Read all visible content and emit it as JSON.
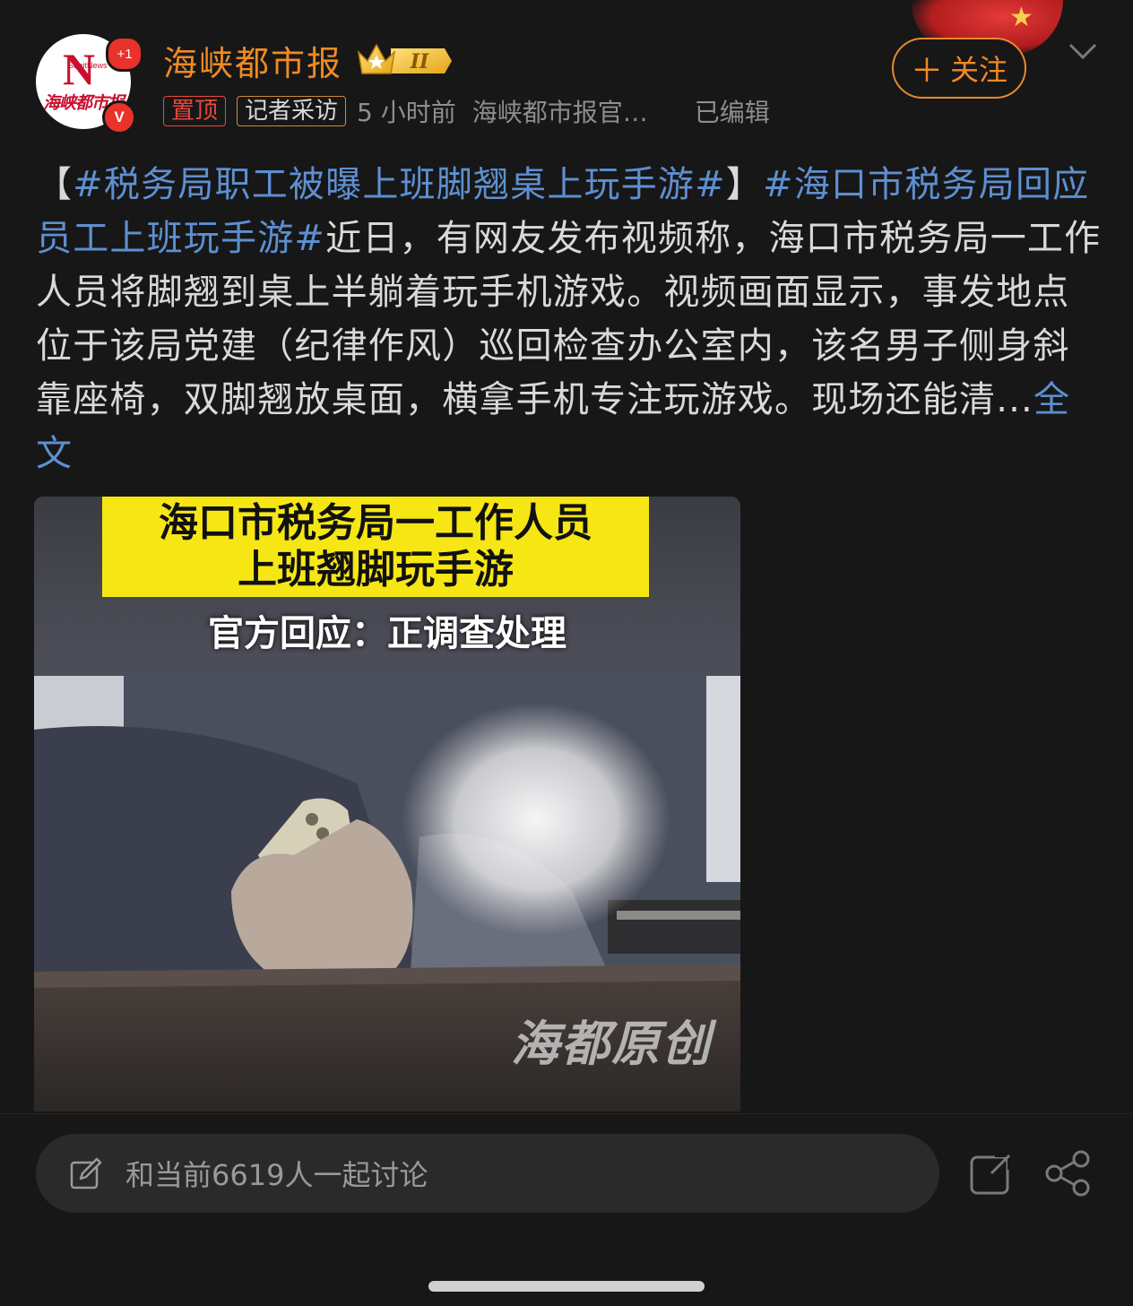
{
  "header": {
    "avatar": {
      "logo_letter": "N",
      "logo_sub": "StraitNews",
      "logo_cn": "海峡都市报"
    },
    "avatar_badge": "+1",
    "verified_badge": "V",
    "author_name": "海峡都市报",
    "level_badge": "II",
    "tags": {
      "pinned": "置顶",
      "reporter": "记者采访"
    },
    "time": "5 小时前",
    "source": "海峡都市报官…",
    "edited": "已编辑",
    "follow_plus": "＋",
    "follow_label": "关注"
  },
  "post": {
    "bracket_open": "【",
    "hashtag1": "#税务局职工被曝上班脚翘桌上玩手游#",
    "bracket_close": "】",
    "hashtag2": "#海口市税务局回应员工上班玩手游#",
    "body": "近日，有网友发布视频称，海口市税务局一工作人员将脚翘到桌上半躺着玩手机游戏。视频画面显示，事发地点位于该局党建（纪律作风）巡回检查办公室内，该名男子侧身斜靠座椅，双脚翘放桌面，横拿手机专注玩游戏。现场还能清...",
    "more": "全文"
  },
  "media": {
    "headline_line1": "海口市税务局一工作人员",
    "headline_line2": "上班翘脚玩手游",
    "subtitle": "官方回应：正调查处理",
    "watermark": "海都原创"
  },
  "footer": {
    "comment_placeholder": "和当前6619人一起讨论",
    "icons": [
      "edit-icon",
      "comment-compose-icon",
      "share-icon"
    ]
  },
  "colors": {
    "background": "#171717",
    "accent_orange": "#f08a24",
    "hashtag_blue": "#5e8fd0",
    "badge_red": "#e8322a",
    "caption_yellow": "#f6e714"
  }
}
